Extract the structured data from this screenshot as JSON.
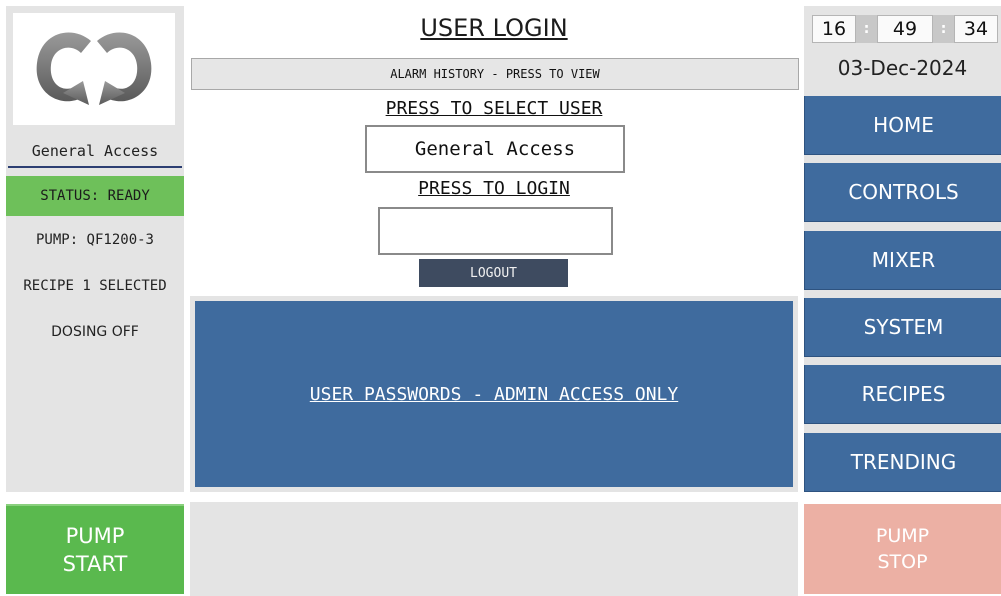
{
  "left_panel": {
    "logo_icon": "circular-arrows-logo-icon",
    "user": "General Access",
    "status": "STATUS: READY",
    "pump": "PUMP: QF1200-3",
    "recipe": "RECIPE 1 SELECTED",
    "dosing": "DOSING OFF"
  },
  "center": {
    "title": "USER LOGIN",
    "alarm_history": "ALARM HISTORY - PRESS TO VIEW",
    "select_user_label": "PRESS TO SELECT USER",
    "selected_user": "General Access",
    "login_label": "PRESS TO LOGIN",
    "password_value": "",
    "logout": "LOGOUT",
    "admin_passwords": "USER PASSWORDS - ADMIN ACCESS ONLY"
  },
  "right_panel": {
    "time": {
      "hours": "16",
      "minutes": "49",
      "seconds": "34",
      "separator": ":"
    },
    "date": "03-Dec-2024",
    "nav": {
      "home": "HOME",
      "controls": "CONTROLS",
      "mixer": "MIXER",
      "system": "SYSTEM",
      "recipes": "RECIPES",
      "trending": "TRENDING"
    }
  },
  "bottom": {
    "pump_start": {
      "line1": "PUMP",
      "line2": "START"
    },
    "pump_stop": {
      "line1": "PUMP",
      "line2": "STOP"
    }
  },
  "colors": {
    "nav_blue": "#3f6b9e",
    "status_green": "#6ec05a",
    "start_green": "#5ab94e",
    "stop_pink": "#ecb0a4",
    "panel_gray": "#e4e4e4",
    "logout_dark": "#3e4b60"
  }
}
